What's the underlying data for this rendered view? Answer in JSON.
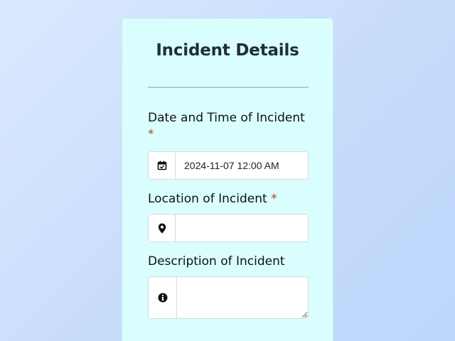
{
  "form": {
    "title": "Incident Details",
    "date_label": "Date and Time of Incident",
    "date_required_mark": "*",
    "date_value": "2024-11-07 12:00 AM",
    "location_label": "Location of Incident",
    "location_required_mark": "*",
    "location_value": "",
    "description_label": "Description of Incident",
    "description_value": ""
  },
  "icons": {
    "date": "calendar-check-icon",
    "location": "map-marker-icon",
    "description": "info-circle-icon"
  },
  "colors": {
    "card_background": "#dafefe",
    "required_mark": "#c0392b",
    "title_text": "#1f2d3d"
  }
}
